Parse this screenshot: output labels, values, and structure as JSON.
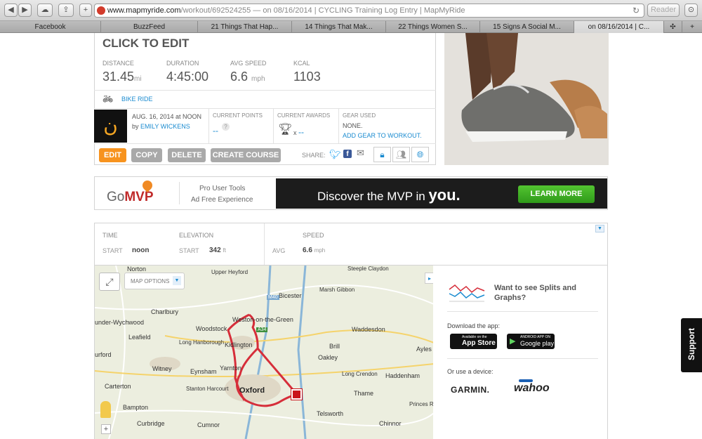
{
  "browser": {
    "url_host": "www.mapmyride.com",
    "url_rest": "/workout/692524255 — on 08/16/2014 | CYCLING Training Log Entry | MapMyRide",
    "reader_label": "Reader",
    "tabs": [
      "Facebook",
      "BuzzFeed",
      "21 Things That Hap...",
      "14 Things That Mak...",
      "22 Things Women S...",
      "15 Signs A Social M...",
      "on 08/16/2014 | C..."
    ]
  },
  "workout": {
    "title": "CLICK TO EDIT",
    "stats": [
      {
        "label": "DISTANCE",
        "value": "31.45",
        "unit": "mi"
      },
      {
        "label": "DURATION",
        "value": "4:45:00",
        "unit": ""
      },
      {
        "label": "AVG SPEED",
        "value": "6.6",
        "unit": "mph"
      },
      {
        "label": "KCAL",
        "value": "1103",
        "unit": ""
      }
    ],
    "activity": "BIKE RIDE",
    "date": "AUG. 16, 2014 at NOON",
    "by_prefix": "by",
    "author": "EMILY WICKENS",
    "current_points_label": "CURRENT POINTS",
    "current_points_value": "--",
    "current_awards_label": "CURRENT AWARDS",
    "awards_prefix": "x",
    "awards_value": "--",
    "gear_label": "GEAR USED",
    "gear_value": "NONE.",
    "add_gear": "ADD GEAR TO WORKOUT.",
    "buttons": {
      "edit": "EDIT",
      "copy": "COPY",
      "delete": "DELETE",
      "create_course": "CREATE COURSE"
    },
    "share_label": "SHARE:"
  },
  "ad": {
    "go": "Go",
    "mvp": "MVP",
    "line1": "Pro User Tools",
    "line2": "Ad Free Experience",
    "discover": "Discover the MVP in",
    "you": "you.",
    "learn_more": "LEARN MORE"
  },
  "details": {
    "time_label": "TIME",
    "elevation_label": "ELEVATION",
    "speed_label": "SPEED",
    "start_label": "START",
    "start_time": "noon",
    "start_elev": "342",
    "elev_unit": "ft",
    "avg_label": "AVG",
    "avg_speed": "6.6",
    "speed_unit": "mph"
  },
  "map": {
    "options_label": "MAP OPTIONS",
    "labels": [
      "Norton",
      "Upper Heyford",
      "Steeple Claydon",
      "Marsh Gibbon",
      "Bicester",
      "Charlbury",
      "under-Wychwood",
      "Weston-on-the-Green",
      "Waddesdon",
      "Woodstock",
      "Leafield",
      "Long Hanborough",
      "Kidlington",
      "Brill",
      "Ayles",
      "Witney",
      "Eynsham",
      "Yarnton",
      "Oakley",
      "Long Crendon",
      "Haddenham",
      "Carterton",
      "Stanton Harcourt",
      "Oxford",
      "Thame",
      "Bampton",
      "Princes Risborough",
      "Telsworth",
      "Chinnor",
      "Curbridge",
      "urford",
      "Cumnor",
      "M40",
      "A34"
    ]
  },
  "side": {
    "splits_text": "Want to see Splits and Graphs?",
    "download_label": "Download the app:",
    "appstore_small": "Available on the",
    "appstore": "App Store",
    "googleplay_small": "ANDROID APP ON",
    "googleplay": "Google play",
    "device_label": "Or use a device:",
    "garmin": "GARMIN.",
    "wahoo": "wahoo"
  },
  "support_label": "Support"
}
